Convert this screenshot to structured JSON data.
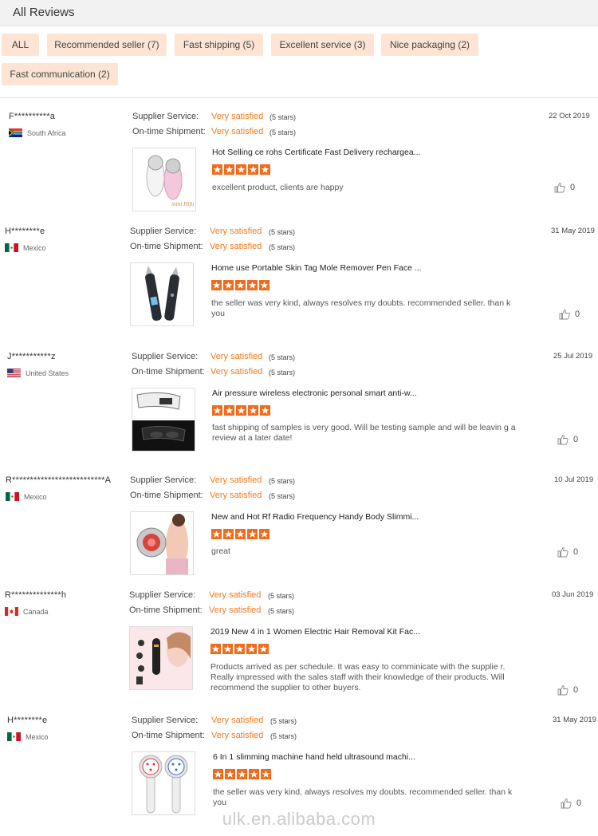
{
  "header": {
    "title": "All Reviews"
  },
  "filters": [
    {
      "label": "ALL"
    },
    {
      "label": "Recommended seller (7)"
    },
    {
      "label": "Fast shipping (5)"
    },
    {
      "label": "Excellent service (3)"
    },
    {
      "label": "Nice packaging (2)"
    },
    {
      "label": "Fast communication (2)"
    }
  ],
  "labels": {
    "supplier_service": "Supplier Service:",
    "ontime_shipment": "On-time Shipment:",
    "very_satisfied": "Very satisfied",
    "five_stars": "(5 stars)"
  },
  "colors": {
    "accent": "#f07a1e",
    "star": "#f26b1d",
    "chip_bg": "#fde4d4"
  },
  "reviews": [
    {
      "user": "F**********a",
      "country": "South Africa",
      "flag_icon": "south-africa-flag-icon",
      "date": "22 Oct 2019",
      "product_title": "Hot Selling ce rohs Certificate Fast Delivery rechargea...",
      "product_rating": 5,
      "comment": "excellent product, clients are happy",
      "likes": "0",
      "image_text": "mini Hifu"
    },
    {
      "user": "H********e",
      "country": "Mexico",
      "flag_icon": "mexico-flag-icon",
      "date": "31 May 2019",
      "product_title": "Home use Portable Skin Tag Mole Remover Pen Face ...",
      "product_rating": 5,
      "comment": "the seller was very kind, always resolves my doubts. recommended seller. than k you",
      "likes": "0"
    },
    {
      "user": "J***********z",
      "country": "United States",
      "flag_icon": "united-states-flag-icon",
      "date": "25 Jul 2019",
      "product_title": "Air pressure wireless electronic personal smart anti-w...",
      "product_rating": 5,
      "comment": "fast shipping of samples is very good. Will be testing sample and will be leavin g a review at a later date!",
      "likes": "0"
    },
    {
      "user": "R**************************A",
      "country": "Mexico",
      "flag_icon": "mexico-flag-icon",
      "date": "10 Jul 2019",
      "product_title": "New and Hot Rf Radio Frequency Handy Body Slimmi...",
      "product_rating": 5,
      "comment": "great",
      "likes": "0"
    },
    {
      "user": "R**************h",
      "country": "Canada",
      "flag_icon": "canada-flag-icon",
      "date": "03 Jun 2019",
      "product_title": "2019 New 4 in 1 Women Electric Hair Removal Kit Fac...",
      "product_rating": 5,
      "comment": "Products arrived as per schedule. It was easy to comminicate with the supplie r. Really impressed with the sales staff with their knowledge of their products. Will recommend the supplier to other buyers.",
      "likes": "0"
    },
    {
      "user": "H********e",
      "country": "Mexico",
      "flag_icon": "mexico-flag-icon",
      "date": "31 May 2019",
      "product_title": "6 In 1 slimming machine hand held ultrasound machi...",
      "product_rating": 5,
      "comment": "the seller was very kind, always resolves my doubts. recommended seller. than k you",
      "likes": "0"
    }
  ],
  "watermark": "ulk.en.alibaba.com"
}
